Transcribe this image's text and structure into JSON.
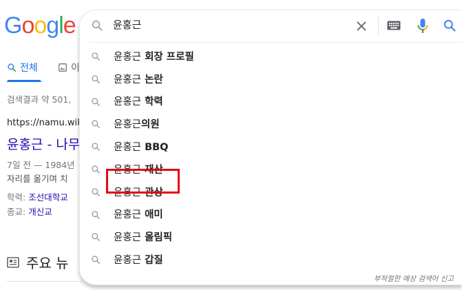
{
  "logo": {
    "letters": [
      "G",
      "o",
      "o",
      "g",
      "l",
      "e"
    ],
    "colors": [
      "#4285F4",
      "#EA4335",
      "#FBBC05",
      "#4285F4",
      "#34A853",
      "#EA4335"
    ]
  },
  "results_page": {
    "tab_all": "전체",
    "tab_images": "이",
    "result_stats": "검색결과 약 501,",
    "result": {
      "url": "https://namu.wiki",
      "title": "윤홍근 - 나무",
      "snippet_line1": "7일 전 — 1984년",
      "snippet_line2": "자리를 옮기며 치",
      "meta1_label": "학력:",
      "meta1_value": "조선대학교",
      "meta2_label": "종교:",
      "meta2_value": "개신교"
    },
    "news_heading": "주요 뉴"
  },
  "search": {
    "query": "윤홍근"
  },
  "suggestions": [
    {
      "prefix": "윤홍근",
      "suffix": " 회장 프로필"
    },
    {
      "prefix": "윤홍근",
      "suffix": " 논란"
    },
    {
      "prefix": "윤홍근",
      "suffix": " 학력"
    },
    {
      "prefix": "윤홍근",
      "suffix": "의원"
    },
    {
      "prefix": "윤홍근",
      "suffix": " BBQ"
    },
    {
      "prefix": "윤홍근",
      "suffix": " 재산"
    },
    {
      "prefix": "윤홍근",
      "suffix": " 관상"
    },
    {
      "prefix": "윤홍근",
      "suffix": " 애미"
    },
    {
      "prefix": "윤홍근",
      "suffix": " 올림픽"
    },
    {
      "prefix": "윤홍근",
      "suffix": " 갑질"
    }
  ],
  "report_link": "부적절한 예상 검색어 신고",
  "colors": {
    "accent": "#1a73e8",
    "link": "#1a0dab",
    "highlight": "#e30613"
  },
  "icons": [
    "search-icon",
    "close-icon",
    "keyboard-icon",
    "microphone-icon",
    "image-icon",
    "news-icon"
  ]
}
